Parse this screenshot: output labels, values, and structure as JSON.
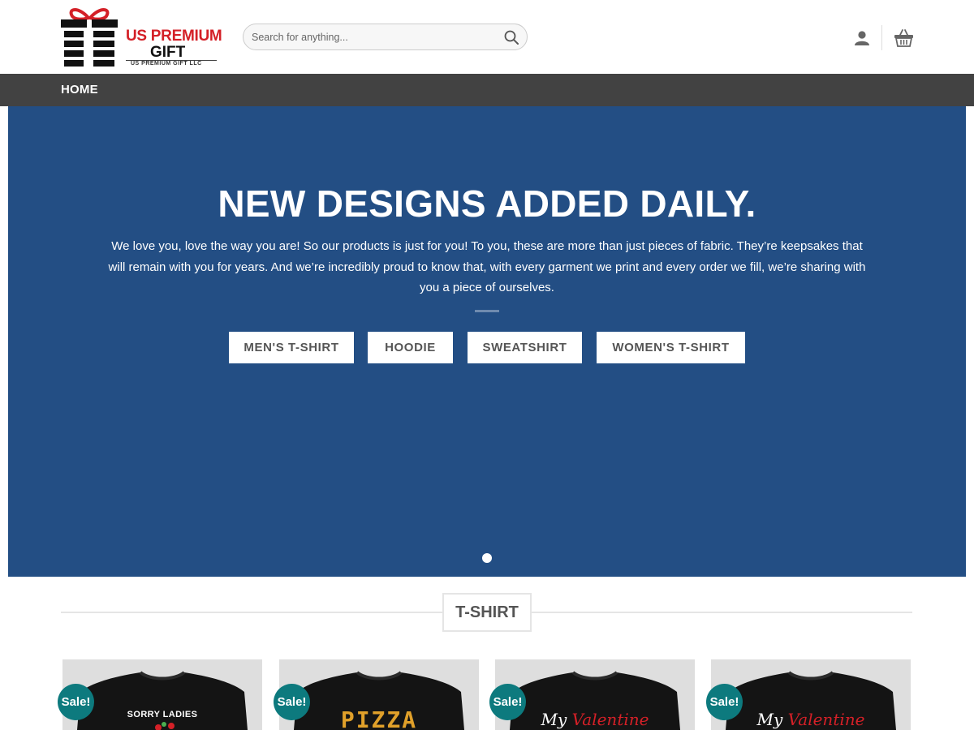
{
  "header": {
    "logo": {
      "line1": "US PREMIUM",
      "line2": "GIFT",
      "line3": "US PREMIUM GIFT LLC"
    },
    "search": {
      "placeholder": "Search for anything..."
    }
  },
  "nav": {
    "home": "HOME"
  },
  "hero": {
    "title": "NEW DESIGNS ADDED DAILY.",
    "text": "We love you, love the way you are! So our products is just for you! To you, these are more than just pieces of fabric. They’re keepsakes that will remain with you for years. And we’re incredibly proud to know that, with every garment we print and every order we fill, we’re sharing with you a piece of ourselves.",
    "buttons": [
      "MEN'S T-SHIRT",
      "HOODIE",
      "SWEATSHIRT",
      "WOMEN'S T-SHIRT"
    ]
  },
  "section": {
    "title": "T-SHIRT"
  },
  "products": [
    {
      "badge": "Sale!",
      "print": "SORRY LADIES"
    },
    {
      "badge": "Sale!",
      "print": "PIZZA"
    },
    {
      "badge": "Sale!",
      "print_a": "My",
      "print_b": "Valentine"
    },
    {
      "badge": "Sale!",
      "print_a": "My",
      "print_b": "Valentine"
    }
  ],
  "colors": {
    "hero_bg": "#234e84",
    "nav_bg": "#424242",
    "sale_badge": "#0d7a7e",
    "logo_red": "#d42027"
  }
}
